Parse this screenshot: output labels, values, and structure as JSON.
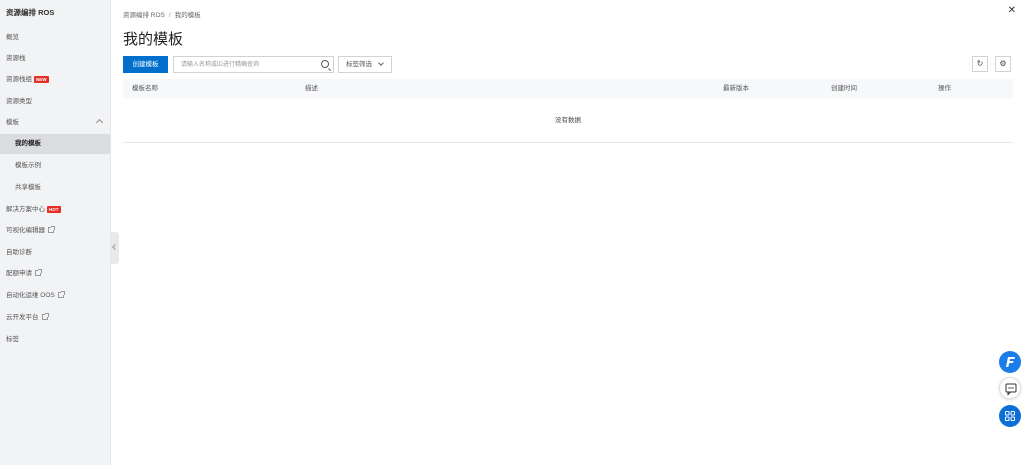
{
  "sidebar": {
    "title": "资源编排 ROS",
    "items": [
      {
        "label": "概览"
      },
      {
        "label": "资源栈"
      },
      {
        "label": "资源栈组",
        "badge": "NEW"
      },
      {
        "label": "资源类型"
      },
      {
        "label": "模板"
      },
      {
        "label": "我的模板"
      },
      {
        "label": "模板示例"
      },
      {
        "label": "共享模板"
      },
      {
        "label": "解决方案中心",
        "badge": "HOT"
      },
      {
        "label": "可视化编辑器"
      },
      {
        "label": "自助诊断"
      },
      {
        "label": "配额申请"
      },
      {
        "label": "自动化运维 OOS"
      },
      {
        "label": "云开发平台"
      },
      {
        "label": "标签"
      }
    ]
  },
  "breadcrumb": {
    "root": "资源编排 ROS",
    "sep": "/",
    "current": "我的模板"
  },
  "page": {
    "title": "我的模板"
  },
  "toolbar": {
    "create_label": "创建模板",
    "search_placeholder": "请输入名称或ID进行精确查询",
    "search_value": "",
    "tag_filter_label": "标签筛选"
  },
  "table": {
    "columns": [
      "模板名称",
      "描述",
      "最新版本",
      "创建时间",
      "操作"
    ],
    "empty_text": "没有数据"
  },
  "colors": {
    "primary": "#0070cc",
    "badge": "#e62d26",
    "sidebar_bg": "#f2f3f5"
  },
  "icons": [
    "search-icon",
    "refresh-icon",
    "settings-icon",
    "close-icon",
    "external-link-icon",
    "chevron-up-icon",
    "chevron-down-icon",
    "chat-icon",
    "apps-icon",
    "feedback-logo-icon"
  ]
}
